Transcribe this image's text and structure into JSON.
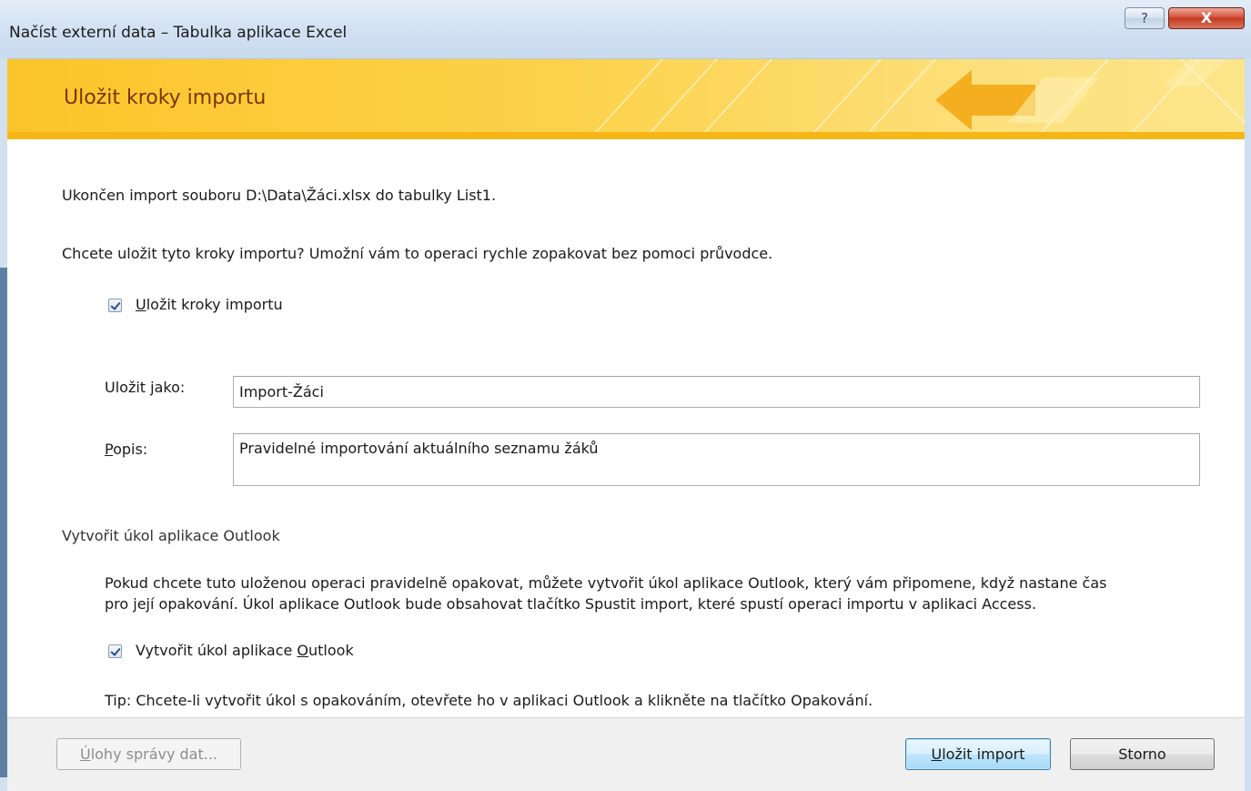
{
  "window": {
    "title": "Načíst externí data – Tabulka aplikace Excel",
    "help_label": "?",
    "close_label": "X"
  },
  "banner": {
    "title": "Uložit kroky importu"
  },
  "main": {
    "status_text": "Ukončen import souboru D:\\Data\\Žáci.xlsx do tabulky List1.",
    "question_text": "Chcete uložit tyto kroky importu? Umožní vám to operaci rychle zopakovat bez pomoci průvodce.",
    "save_steps_checkbox": {
      "checked": true,
      "label_prefix": "",
      "label_mnemonic": "U",
      "label_rest": "ložit kroky importu"
    },
    "save_as": {
      "label_prefix": "Uložit ",
      "label_mnemonic": "j",
      "label_rest": "ako:",
      "value": "Import-Žáci"
    },
    "description": {
      "label_prefix": "",
      "label_mnemonic": "P",
      "label_rest": "opis:",
      "value": "Pravidelné importování aktuálního seznamu žáků"
    },
    "outlook_section": {
      "heading": "Vytvořit úkol aplikace Outlook",
      "info_line1": "Pokud chcete tuto uloženou operaci pravidelně opakovat, můžete vytvořit úkol aplikace Outlook, který vám připomene, když nastane čas",
      "info_line2": "pro její opakování. Úkol aplikace Outlook bude obsahovat tlačítko Spustit import, které spustí operaci importu v aplikaci Access.",
      "checkbox": {
        "checked": true,
        "label_prefix": "Vytvořit úkol aplikace ",
        "label_mnemonic": "O",
        "label_rest": "utlook"
      },
      "tip": "Tip: Chcete-li vytvořit úkol s opakováním, otevřete ho v aplikaci Outlook a klikněte na tlačítko Opakování."
    }
  },
  "footer": {
    "manage_button": {
      "mnemonic": "Ú",
      "rest": "lohy správy dat...",
      "enabled": false
    },
    "save_button": {
      "mnemonic": "U",
      "rest": "ložit import"
    },
    "cancel_button": {
      "label": "Storno"
    }
  },
  "colors": {
    "banner_title": "#7a3500",
    "banner_bg": "#fcd24a",
    "titlebar_bg": "#d4e2f2"
  }
}
